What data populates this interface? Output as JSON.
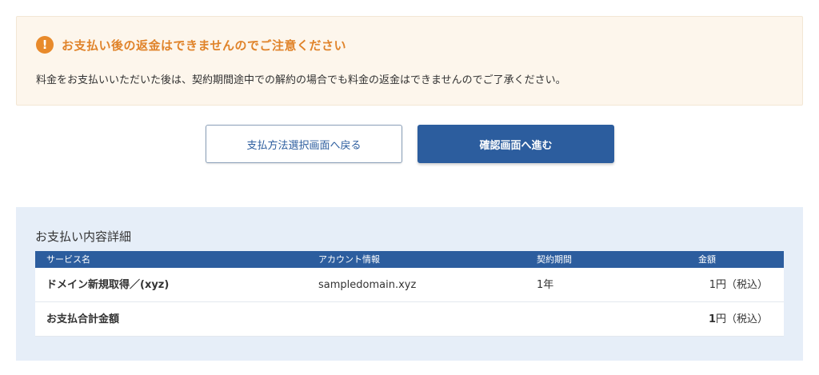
{
  "notice": {
    "icon": "exclamation-icon",
    "title": "お支払い後の返金はできませんのでご注意ください",
    "text": "料金をお支払いいただいた後は、契約期間途中での解約の場合でも料金の返金はできませんのでご了承ください。"
  },
  "buttons": {
    "back_label": "支払方法選択画面へ戻る",
    "next_label": "確認画面へ進む"
  },
  "details": {
    "title": "お支払い内容詳細",
    "headers": [
      "サービス名",
      "アカウント情報",
      "契約期間",
      "金額"
    ],
    "rows": [
      {
        "service": "ドメイン新規取得／(xyz)",
        "account": "sampledomain.xyz",
        "period": "1年",
        "amount": "1円（税込）"
      }
    ],
    "total": {
      "label": "お支払合計金額",
      "amount_number": "1",
      "amount_suffix": "円（税込）"
    }
  },
  "colors": {
    "accent": "#2c5d9e",
    "warning": "#e88a2b",
    "notice_bg": "#fdf6ec",
    "details_bg": "#e6eef8"
  }
}
